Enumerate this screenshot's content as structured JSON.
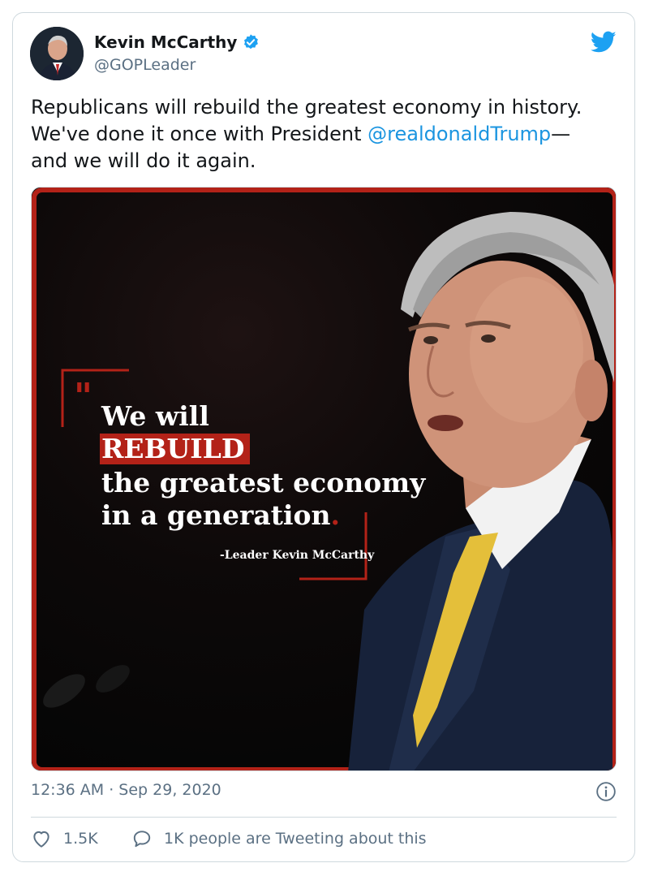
{
  "author": {
    "display_name": "Kevin McCarthy",
    "handle": "@GOPLeader",
    "verified": true
  },
  "tweet": {
    "text_part1": "Republicans will rebuild the greatest economy in history. We've done it once with President ",
    "mention": "@realdonaldTrump",
    "text_part2": "—and we will do it again."
  },
  "media": {
    "quote_line1": "We will",
    "quote_highlight": "REBUILD",
    "quote_line3": "the greatest economy",
    "quote_line4": "in a generation",
    "quote_period": ".",
    "attribution": "-Leader Kevin McCarthy",
    "accent_color": "#b32218"
  },
  "meta": {
    "timestamp": "12:36 AM · Sep 29, 2020"
  },
  "actions": {
    "likes": "1.5K",
    "conversation": "1K people are Tweeting about this"
  },
  "colors": {
    "link": "#1b95e0",
    "secondary_text": "#5b7083",
    "twitter_blue": "#1da1f2"
  }
}
